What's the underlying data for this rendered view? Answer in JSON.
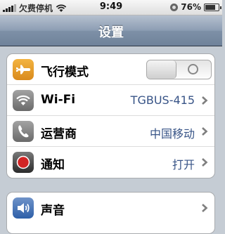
{
  "status_bar": {
    "carrier": "欠费停机",
    "time": "9:49",
    "battery_percent": "76%",
    "battery_level": 0.76,
    "signal_bars": 4,
    "icons": [
      "signal-icon",
      "wifi-icon",
      "rotation-lock-icon",
      "battery-icon"
    ]
  },
  "nav": {
    "title": "设置"
  },
  "groups": [
    {
      "items": [
        {
          "label": "飞行模式",
          "icon": "airplane-icon",
          "control": "toggle",
          "toggle_on": false
        },
        {
          "label": "Wi-Fi",
          "value": "TGBUS-415",
          "icon": "wifi-icon"
        },
        {
          "label": "运营商",
          "value": "中国移动",
          "icon": "phone-icon"
        },
        {
          "label": "通知",
          "value": "打开",
          "icon": "notifications-icon"
        }
      ]
    },
    {
      "items": [
        {
          "label": "声音",
          "icon": "sound-icon"
        }
      ]
    }
  ],
  "colors": {
    "value_text": "#385487",
    "airplane_icon_bg": "#e8a230",
    "notification_icon_bg": "#c62020"
  }
}
